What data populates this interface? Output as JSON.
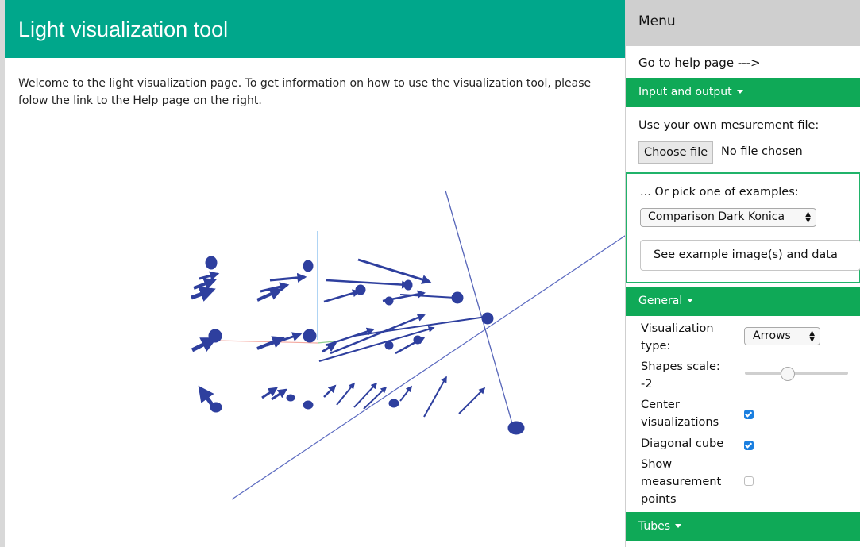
{
  "main": {
    "title": "Light visualization tool",
    "welcome": "Welcome to the light visualization page. To get information on how to use the visualization tool, please folow the link to the Help page on the right."
  },
  "menu": {
    "title": "Menu",
    "help_link": "Go to help page --->",
    "input_output": {
      "label": "Input and output",
      "own_file_label": "Use your own mesurement file:",
      "choose_file_button": "Choose file",
      "file_status": "No file chosen"
    },
    "examples": {
      "label": "... Or pick one of examples:",
      "selected": "Comparison Dark Konica",
      "see_button": "See example image(s) and data"
    },
    "general": {
      "label": "General",
      "viz_type_label": "Visualization type:",
      "viz_type_value": "Arrows",
      "shapes_scale_label": "Shapes scale: -2",
      "center_label": "Center visualizations",
      "center_checked": true,
      "diagonal_label": "Diagonal cube",
      "diagonal_checked": true,
      "show_points_label": "Show measurement points",
      "show_points_checked": false
    },
    "tubes": {
      "label": "Tubes"
    }
  },
  "colors": {
    "header": "#00a78b",
    "section": "#0fa957",
    "arrow": "#2e3f9e",
    "checkbox": "#1a7fe0"
  },
  "icons": {
    "caret": "caret-down-icon",
    "select_arrows": "select-updown-icon"
  }
}
